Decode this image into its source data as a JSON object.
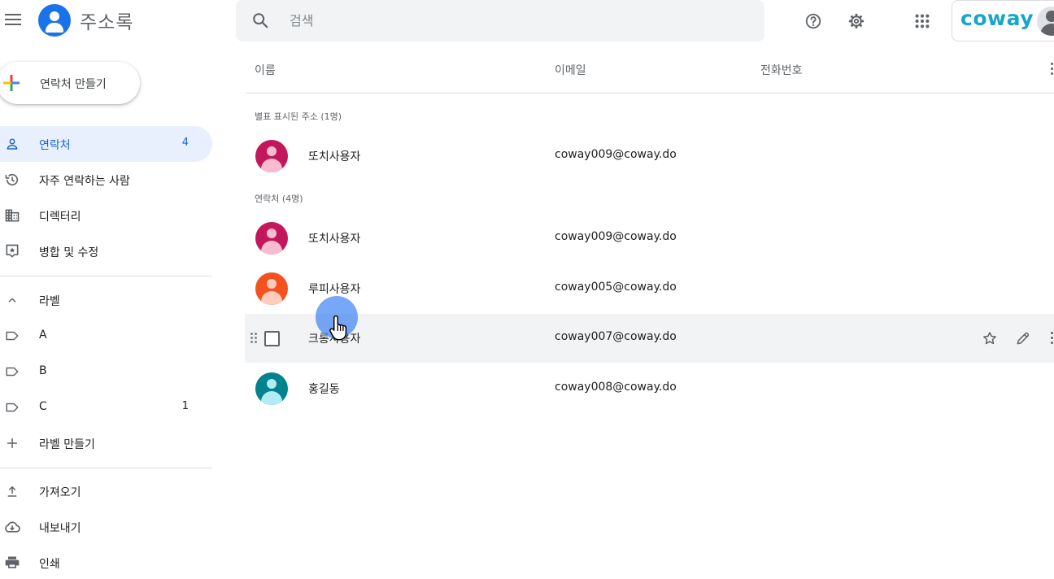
{
  "header": {
    "app_title": "주소록",
    "search_placeholder": "검색",
    "brand": "coway"
  },
  "sidebar": {
    "create_label": "연락처 만들기",
    "nav": [
      {
        "label": "연락처",
        "count": "4",
        "icon": "person-icon",
        "active": true
      },
      {
        "label": "자주 연락하는 사람",
        "icon": "history-icon"
      },
      {
        "label": "디렉터리",
        "icon": "building-icon"
      },
      {
        "label": "병합 및 수정",
        "icon": "merge-icon"
      }
    ],
    "labels_header": "라벨",
    "labels": [
      {
        "label": "A",
        "count": ""
      },
      {
        "label": "B",
        "count": ""
      },
      {
        "label": "C",
        "count": "1"
      }
    ],
    "create_label_label": "라벨 만들기",
    "actions": [
      {
        "label": "가져오기",
        "icon": "upload-icon"
      },
      {
        "label": "내보내기",
        "icon": "cloud-download-icon"
      },
      {
        "label": "인쇄",
        "icon": "print-icon"
      }
    ]
  },
  "list": {
    "columns": [
      "이름",
      "이메일",
      "전화번호"
    ],
    "starred_section": "별표 표시된 주소 (1명)",
    "contacts_section": "연락처 (4명)",
    "starred": [
      {
        "name": "또치사용자",
        "email": "coway009@coway.do",
        "color": "#c2185b"
      }
    ],
    "contacts": [
      {
        "name": "또치사용자",
        "email": "coway009@coway.do",
        "color": "#c2185b"
      },
      {
        "name": "루피사용자",
        "email": "coway005@coway.do",
        "color": "#f4511e"
      },
      {
        "name": "크롱사용자",
        "email": "coway007@coway.do",
        "color": "",
        "hovered": true
      },
      {
        "name": "홍길동",
        "email": "coway008@coway.do",
        "color": "#00838f"
      }
    ]
  },
  "colors": {
    "accent": "#1a73e8",
    "active_bg": "#e8f0fe",
    "brand": "#18a6c8"
  }
}
